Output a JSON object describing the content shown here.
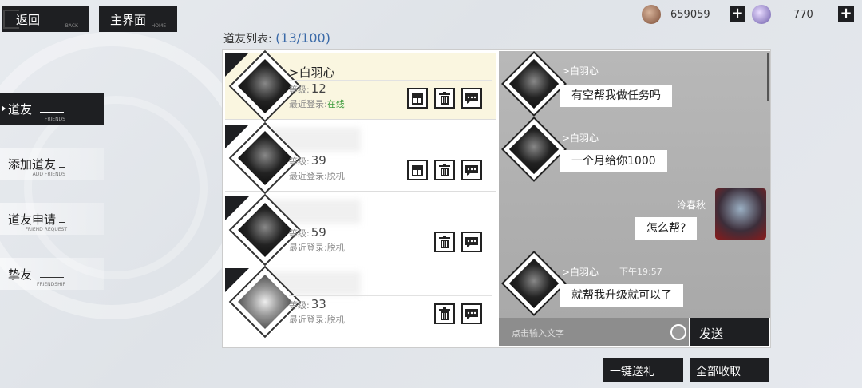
{
  "top": {
    "back_label": "返回",
    "back_sub": "BACK",
    "home_label": "主界面",
    "home_sub": "HOME",
    "coins": "659059",
    "gems": "770",
    "plus": "+"
  },
  "sidebar": {
    "items": [
      {
        "label": "道友",
        "sub": "FRIENDS"
      },
      {
        "label": "添加道友",
        "sub": "ADD FRIENDS"
      },
      {
        "label": "道友申请",
        "sub": "FRIEND REQUEST"
      },
      {
        "label": "挚友",
        "sub": "FRIENDSHIP"
      }
    ]
  },
  "list": {
    "title": "道友列表:",
    "count": "(13/100)",
    "level_label": "等级:",
    "login_label": "最近登录:",
    "friends": [
      {
        "name": ">白羽心",
        "level": "12",
        "status": "在线"
      },
      {
        "name": "",
        "level": "39",
        "status": "脱机"
      },
      {
        "name": "",
        "level": "59",
        "status": "脱机"
      },
      {
        "name": "",
        "level": "33",
        "status": "脱机"
      }
    ]
  },
  "chat": {
    "messages": [
      {
        "sender": ">白羽心",
        "text": "有空帮我做任务吗"
      },
      {
        "sender": ">白羽心",
        "text": "一个月给你1000"
      },
      {
        "sender": "泠春秋",
        "text": "怎么帮?"
      },
      {
        "sender": ">白羽心",
        "time": "下午19:57",
        "text": "就帮我升级就可以了"
      }
    ],
    "input_placeholder": "点击输入文字",
    "send_label": "发送"
  },
  "bottom": {
    "gift_all_label": "一键送礼",
    "collect_all_label": "全部收取"
  }
}
